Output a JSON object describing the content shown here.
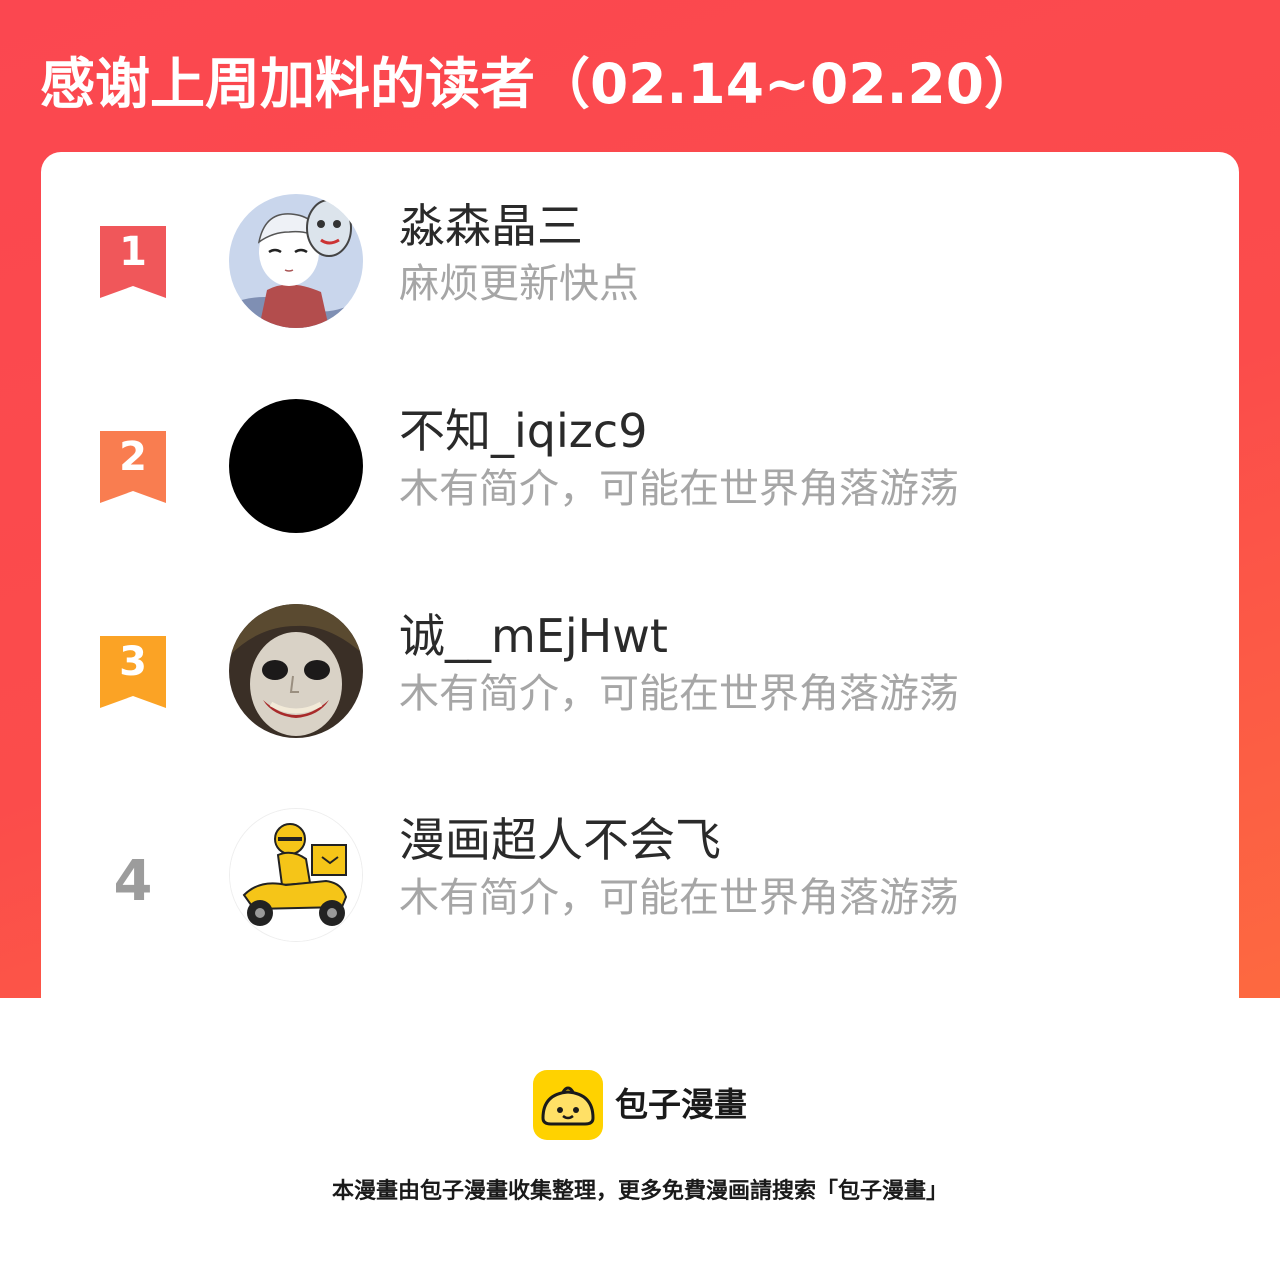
{
  "header": {
    "title": "感谢上周加料的读者（02.14~02.20）"
  },
  "readers": [
    {
      "rank": "1",
      "name": "淼森晶三",
      "bio": "麻烦更新快点",
      "rank_color": "#f0575a",
      "avatar": "anime-boy-with-mask-avatar"
    },
    {
      "rank": "2",
      "name": "不知_iqizc9",
      "bio": "木有简介，可能在世界角落游荡",
      "rank_color": "#f97d50",
      "avatar": "black-circle-avatar"
    },
    {
      "rank": "3",
      "name": "诚__mEjHwt",
      "bio": "木有简介，可能在世界角落游荡",
      "rank_color": "#fba325",
      "avatar": "joker-face-avatar"
    },
    {
      "rank": "4",
      "name": "漫画超人不会飞",
      "bio": "木有简介，可能在世界角落游荡",
      "rank_color": "#9c9c9c",
      "avatar": "delivery-scooter-avatar"
    }
  ],
  "footer": {
    "brand_name": "包子漫畫",
    "brand_color": "#ffd200",
    "note": "本漫畫由包子漫畫收集整理，更多免費漫画請搜索「包子漫畫」"
  }
}
